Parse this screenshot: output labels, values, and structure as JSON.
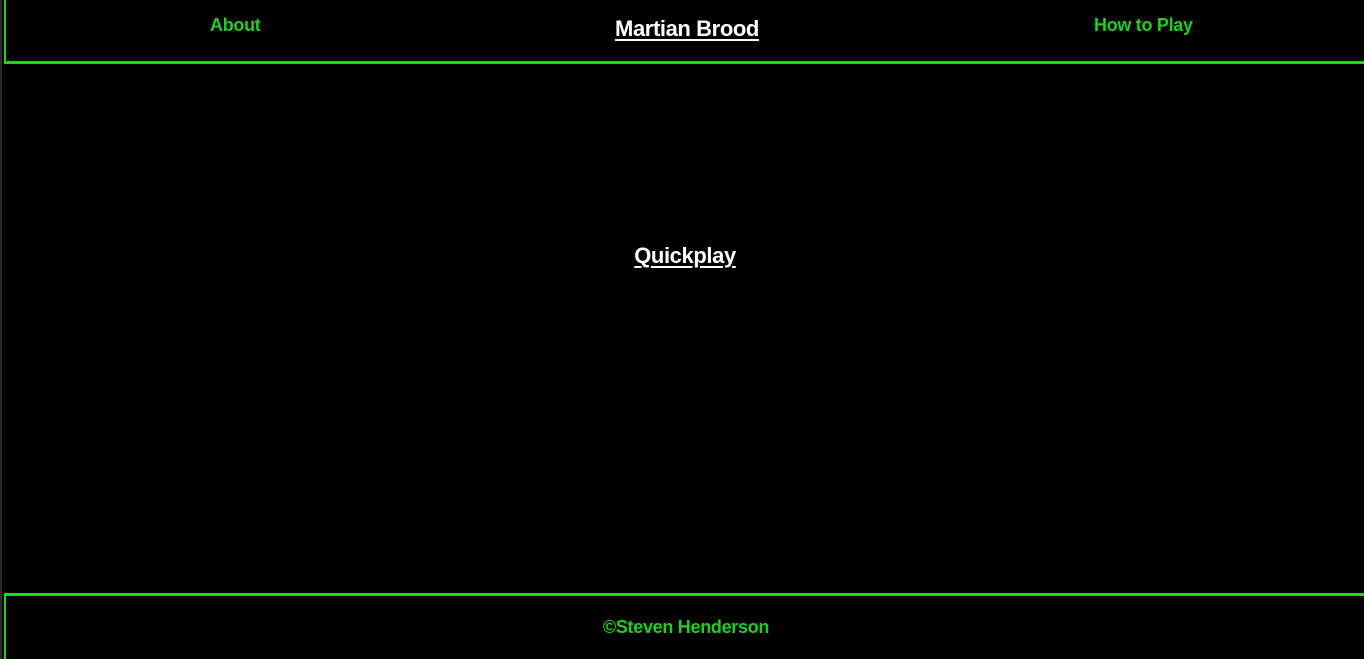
{
  "header": {
    "title": "Martian Brood",
    "nav_left": "About",
    "nav_right": "How to Play"
  },
  "main": {
    "quickplay_label": "Quickplay"
  },
  "footer": {
    "copyright": "©Steven Henderson"
  },
  "colors": {
    "background": "#000000",
    "accent_green": "#22d122",
    "title_text": "#ffffff"
  }
}
